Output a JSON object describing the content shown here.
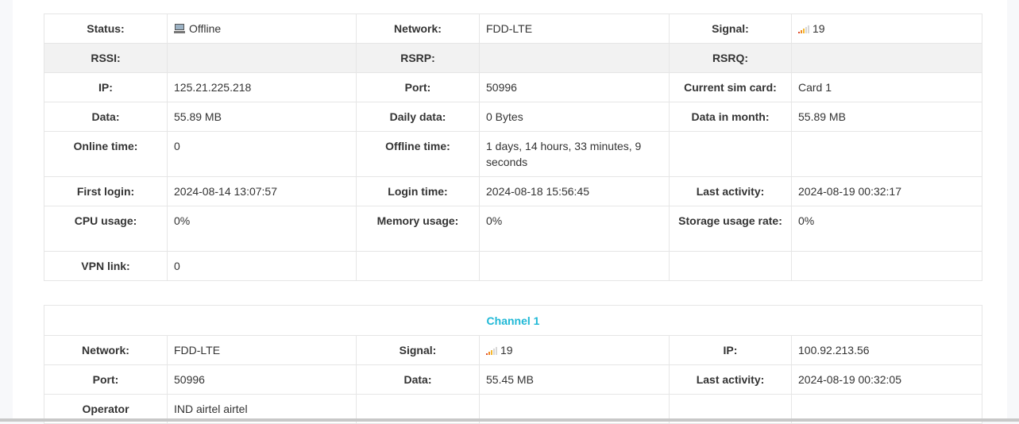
{
  "device": {
    "status_label": "Status:",
    "status_value": "Offline",
    "status_icon": "computer-icon",
    "network_label": "Network:",
    "network_value": "FDD-LTE",
    "signal_label": "Signal:",
    "signal_value": "19",
    "signal_icon": "signal-bars-icon",
    "rssi_label": "RSSI:",
    "rsrp_label": "RSRP:",
    "rsrq_label": "RSRQ:",
    "ip_label": "IP:",
    "ip_value": "125.21.225.218",
    "port_label": "Port:",
    "port_value": "50996",
    "sim_label": "Current sim card:",
    "sim_value": "Card 1",
    "data_label": "Data:",
    "data_value": "55.89 MB",
    "daily_label": "Daily data:",
    "daily_value": "0 Bytes",
    "month_label": "Data in month:",
    "month_value": "55.89 MB",
    "online_label": "Online time:",
    "online_value": "0",
    "offline_label": "Offline time:",
    "offline_value": "1 days, 14 hours, 33 minutes, 9 seconds",
    "first_login_label": "First login:",
    "first_login_value": "2024-08-14 13:07:57",
    "login_time_label": "Login time:",
    "login_time_value": "2024-08-18 15:56:45",
    "last_activity_label": "Last activity:",
    "last_activity_value": "2024-08-19 00:32:17",
    "cpu_label": "CPU usage:",
    "cpu_value": "0%",
    "memory_label": "Memory usage:",
    "memory_value": "0%",
    "storage_label": "Storage usage rate:",
    "storage_value": "0%",
    "vpn_label": "VPN link:",
    "vpn_value": "0"
  },
  "channel1": {
    "title": "Channel 1",
    "network_label": "Network:",
    "network_value": "FDD-LTE",
    "signal_label": "Signal:",
    "signal_value": "19",
    "ip_label": "IP:",
    "ip_value": "100.92.213.56",
    "port_label": "Port:",
    "port_value": "50996",
    "data_label": "Data:",
    "data_value": "55.45 MB",
    "last_activity_label": "Last activity:",
    "last_activity_value": "2024-08-19 00:32:05",
    "operator_label": "Operator",
    "operator_value": "IND airtel airtel"
  },
  "colors": {
    "accent": "#1fb8d6",
    "gray_row": "#f2f2f2",
    "border": "#e6e6e6"
  }
}
